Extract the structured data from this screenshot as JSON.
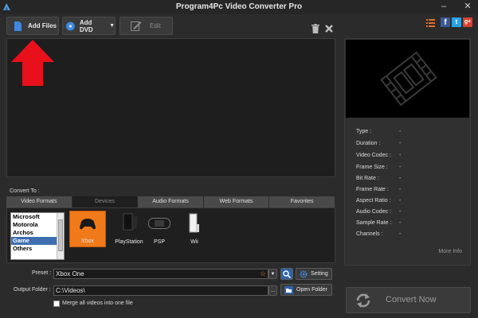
{
  "window": {
    "title": "Program4Pc Video Converter Pro"
  },
  "toolbar": {
    "add_files": "Add Files",
    "add_dvd": "Add DVD",
    "edit": "Edit"
  },
  "info": {
    "rows": [
      {
        "key": "Type :",
        "value": "-"
      },
      {
        "key": "Duration :",
        "value": "-"
      },
      {
        "key": "Video Codec :",
        "value": "-"
      },
      {
        "key": "Frame Size :",
        "value": "-"
      },
      {
        "key": "Bit Rate :",
        "value": "-"
      },
      {
        "key": "Frame Rate :",
        "value": "-"
      },
      {
        "key": "Aspect Ratio :",
        "value": "-"
      },
      {
        "key": "Audio Codec :",
        "value": "-"
      },
      {
        "key": "Sample Rate :",
        "value": "-"
      },
      {
        "key": "Channels :",
        "value": "-"
      }
    ],
    "more_info": "More Info"
  },
  "convert_to": {
    "label": "Convert To :",
    "tabs": [
      "Video Formats",
      "Devices",
      "Audio Formats",
      "Web Formats",
      "Favorites"
    ],
    "active_tab": "Devices",
    "brands": [
      "Microsoft",
      "Motorola",
      "Archos",
      "Game",
      "Others"
    ],
    "selected_brand": "Game",
    "devices": [
      "Xbox",
      "PlayStation",
      "PSP",
      "Wii"
    ],
    "selected_device": "Xbox"
  },
  "preset": {
    "label": "Preset :",
    "value": "Xbox One",
    "setting_label": "Setting"
  },
  "output": {
    "label": "Output Folder :",
    "value": "C:\\Videos\\",
    "browse_label": "...",
    "open_folder_label": "Open Folder"
  },
  "merge": {
    "label": "Merge all videos into one file"
  },
  "convert_now": {
    "label": "Convert Now"
  },
  "colors": {
    "accent_orange": "#f07a1a",
    "arrow_red": "#e8101a",
    "selection_blue": "#3d6fb0"
  },
  "icons": {
    "social": [
      "list-icon",
      "facebook-icon",
      "twitter-icon",
      "google-plus-icon"
    ],
    "toolbar": [
      "file-icon",
      "disc-icon",
      "edit-icon",
      "trash-icon",
      "close-icon"
    ]
  }
}
